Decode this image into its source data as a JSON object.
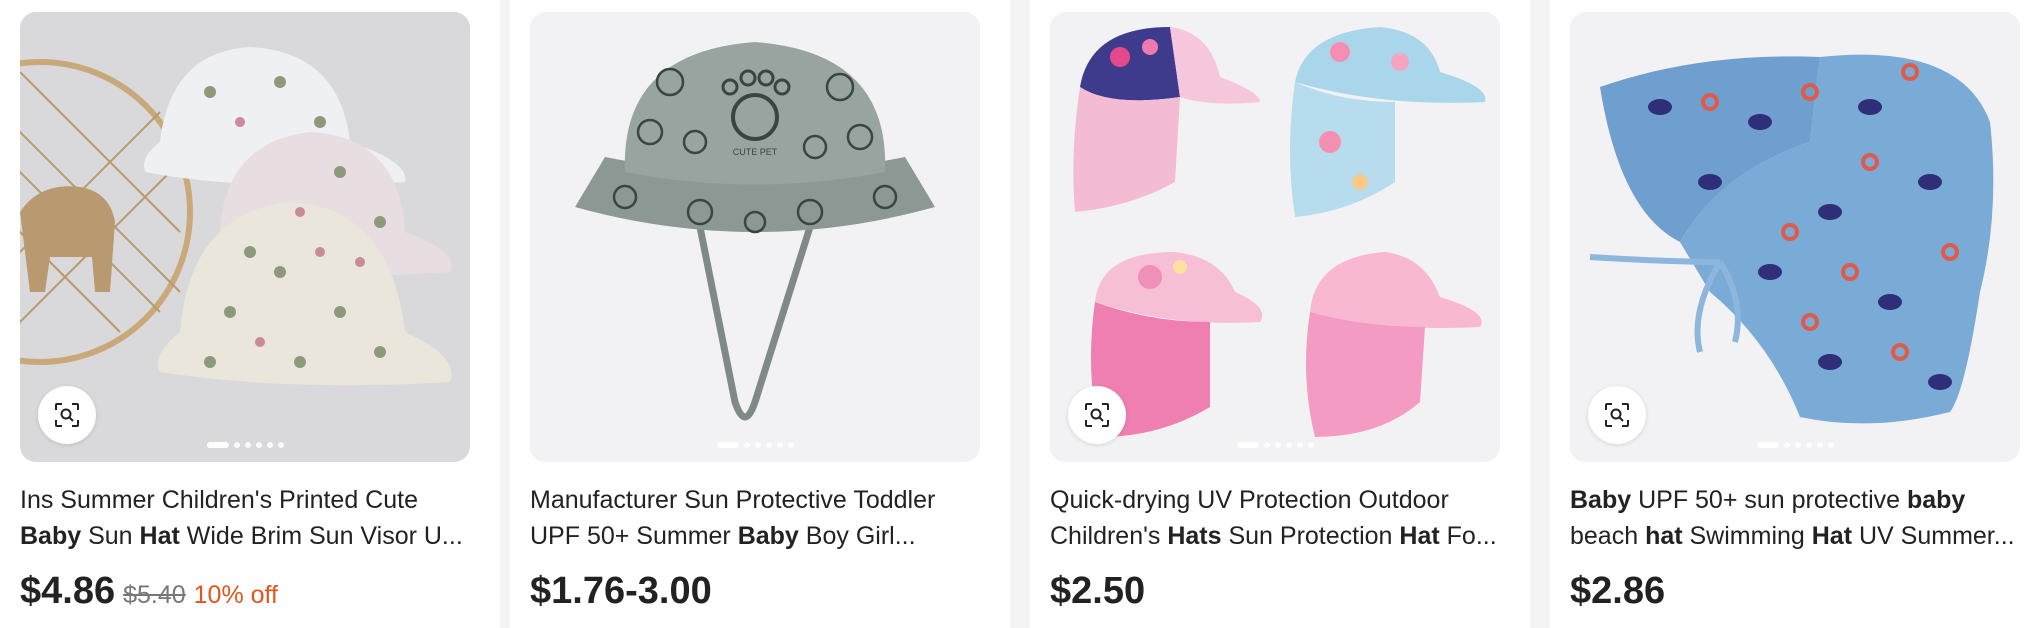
{
  "products": [
    {
      "title_parts": [
        {
          "text": "Manufacturer Sun Protective Toddler UPF 50+ Summer ",
          "bold": false
        },
        {
          "text": "Baby",
          "bold": true
        },
        {
          "text": " Boy Girl...",
          "bold": false
        }
      ],
      "price": "$1.76-3.00",
      "image_label": "CUTE PET",
      "image_alt": "grey bucket hat with paw and cat prints",
      "has_visual_search": false,
      "carousel_dots": 6
    },
    {
      "title_parts": [
        {
          "text": "Quick-drying UV Protection Outdoor Children's ",
          "bold": false
        },
        {
          "text": "Hats",
          "bold": true
        },
        {
          "text": " Sun Protection ",
          "bold": false
        },
        {
          "text": "Hat",
          "bold": true
        },
        {
          "text": " Fo...",
          "bold": false
        }
      ],
      "price": "$2.50",
      "image_alt": "four pink and floral flap sun hats",
      "has_visual_search": true,
      "carousel_dots": 6
    },
    {
      "title_parts": [
        {
          "text": "Baby",
          "bold": true
        },
        {
          "text": " UPF 50+ sun protective ",
          "bold": false
        },
        {
          "text": "baby",
          "bold": true
        },
        {
          "text": " beach ",
          "bold": false
        },
        {
          "text": "hat",
          "bold": true
        },
        {
          "text": " Swimming ",
          "bold": false
        },
        {
          "text": "Hat",
          "bold": true
        },
        {
          "text": " UV Summer...",
          "bold": false
        }
      ],
      "price": "$2.86",
      "image_alt": "blue flap hat with whale print",
      "has_visual_search": true,
      "carousel_dots": 6
    },
    {
      "title_parts": [
        {
          "text": "Ins Summer Children's Printed Cute ",
          "bold": false
        },
        {
          "text": "Baby",
          "bold": true
        },
        {
          "text": " Sun ",
          "bold": false
        },
        {
          "text": "Hat",
          "bold": true
        },
        {
          "text": " Wide Brim Sun Visor U...",
          "bold": false
        }
      ],
      "price": "$4.86",
      "original_price": "$5.40",
      "discount": "10% off",
      "image_alt": "floral printed wide brim hats",
      "has_visual_search": true,
      "carousel_dots": 6
    }
  ],
  "colors": {
    "price": "#222222",
    "discount": "#e0561b",
    "strikethrough": "#777777",
    "card_bg": "#ffffff",
    "image_bg": "#f2f2f4"
  },
  "icons": {
    "visual_search": "image-search-icon"
  }
}
